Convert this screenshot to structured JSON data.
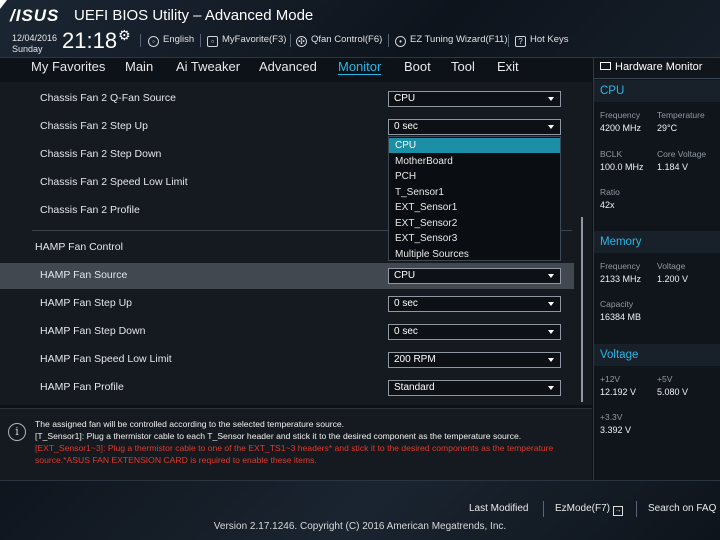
{
  "header": {
    "logo": "/ISUS",
    "title": "UEFI BIOS Utility – Advanced Mode",
    "date": "12/04/2016",
    "day": "Sunday",
    "time": "21:18",
    "tools": [
      {
        "label": "English",
        "icon": "globe-icon"
      },
      {
        "label": "MyFavorite(F3)",
        "icon": "favorite-icon"
      },
      {
        "label": "Qfan Control(F6)",
        "icon": "fan-icon"
      },
      {
        "label": "EZ Tuning Wizard(F11)",
        "icon": "bulb-icon"
      },
      {
        "label": "Hot Keys",
        "icon": "help-icon"
      }
    ]
  },
  "tabs": [
    {
      "label": "My Favorites"
    },
    {
      "label": "Main"
    },
    {
      "label": "Ai Tweaker"
    },
    {
      "label": "Advanced"
    },
    {
      "label": "Monitor",
      "active": true
    },
    {
      "label": "Boot"
    },
    {
      "label": "Tool"
    },
    {
      "label": "Exit"
    }
  ],
  "settings": {
    "rows": [
      {
        "label": "Chassis Fan 2 Q-Fan Source",
        "value": "CPU"
      },
      {
        "label": "Chassis Fan 2 Step Up",
        "value": "0 sec"
      },
      {
        "label": "Chassis Fan 2 Step Down"
      },
      {
        "label": "Chassis Fan 2 Speed Low Limit"
      },
      {
        "label": "Chassis Fan 2 Profile"
      }
    ],
    "section": "HAMP Fan Control",
    "hamp_rows": [
      {
        "label": "HAMP Fan Source",
        "value": "CPU"
      },
      {
        "label": "HAMP Fan Step Up",
        "value": "0 sec"
      },
      {
        "label": "HAMP Fan Step Down",
        "value": "0 sec"
      },
      {
        "label": "HAMP Fan Speed Low Limit",
        "value": "200 RPM"
      },
      {
        "label": "HAMP Fan Profile",
        "value": "Standard"
      }
    ]
  },
  "dropdown": {
    "options": [
      "CPU",
      "MotherBoard",
      "PCH",
      "T_Sensor1",
      "EXT_Sensor1",
      "EXT_Sensor2",
      "EXT_Sensor3",
      "Multiple Sources"
    ],
    "selected": "CPU"
  },
  "info": {
    "line1": "The assigned fan will be controlled according to the selected temperature source.",
    "line2": "[T_Sensor1]: Plug a thermistor cable to each T_Sensor header and stick it to the desired component as the temperature source.",
    "line3": "[EXT_Sensor1~3]: Plug a thermistor cable to one of the EXT_TS1~3 headers* and stick it to the desired components as the temperature",
    "line4": "source.*ASUS FAN EXTENSION CARD is required to enable these items."
  },
  "hardware_monitor": {
    "title": "Hardware Monitor",
    "cpu": {
      "heading": "CPU",
      "frequency_label": "Frequency",
      "frequency": "4200 MHz",
      "temperature_label": "Temperature",
      "temperature": "29°C",
      "bclk_label": "BCLK",
      "bclk": "100.0 MHz",
      "core_voltage_label": "Core Voltage",
      "core_voltage": "1.184 V",
      "ratio_label": "Ratio",
      "ratio": "42x"
    },
    "memory": {
      "heading": "Memory",
      "frequency_label": "Frequency",
      "frequency": "2133 MHz",
      "voltage_label": "Voltage",
      "voltage": "1.200 V",
      "capacity_label": "Capacity",
      "capacity": "16384 MB"
    },
    "voltage": {
      "heading": "Voltage",
      "v12_label": "+12V",
      "v12": "12.192 V",
      "v5_label": "+5V",
      "v5": "5.080 V",
      "v33_label": "+3.3V",
      "v33": "3.392 V"
    }
  },
  "footer": {
    "last_modified": "Last Modified",
    "ezmode": "EzMode(F7)",
    "search": "Search on FAQ",
    "copyright": "Version 2.17.1246. Copyright (C) 2016 American Megatrends, Inc."
  }
}
